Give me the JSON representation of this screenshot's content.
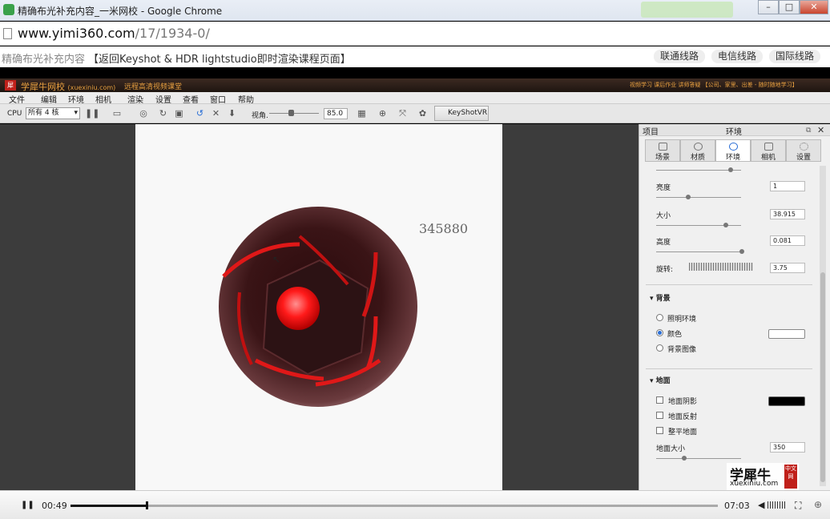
{
  "browser": {
    "window_title": "精确布光补充内容_一米网校 - Google Chrome",
    "url_host": "www.yimi360.com",
    "url_path": "/17/1934-0/"
  },
  "page": {
    "course_title": "精确布光补充内容",
    "back_link": "【返回Keyshot & HDR lightstudio即时渲染课程页面】",
    "routes": [
      "联通线路",
      "电信线路",
      "国际线路"
    ]
  },
  "keyshot": {
    "brand": "学犀牛网校",
    "brand_domain": "(xuexiniu.com)",
    "slogan": "远程高清视频课堂",
    "header_right": "视频学习  课后作业  讲师答疑  【公司、家里、出差 - 随时随地学习】",
    "menu": [
      "文件",
      "编辑",
      "环境",
      "相机",
      "渲染",
      "设置",
      "查看",
      "窗口",
      "帮助"
    ],
    "toolbar": {
      "cpu_label": "CPU",
      "cpu_value": "所有 4 核",
      "fov_label": "视角.",
      "fov_value": "85.0",
      "vr_button": "KeyShotVR"
    },
    "viewport_watermark": "345880"
  },
  "panel": {
    "project_label": "项目",
    "title": "环境",
    "tabs": [
      {
        "label": "场景",
        "icon": "scene-icon"
      },
      {
        "label": "材质",
        "icon": "material-icon"
      },
      {
        "label": "环境",
        "icon": "environment-icon"
      },
      {
        "label": "相机",
        "icon": "camera-icon"
      },
      {
        "label": "设置",
        "icon": "settings-icon"
      }
    ],
    "active_tab": 2,
    "fields": {
      "brightness_label": "亮度",
      "brightness_value": "1",
      "size_label": "大小",
      "size_value": "38.915",
      "height_label": "高度",
      "height_value": "0.081",
      "rotation_label": "旋转:",
      "rotation_value": "3.75"
    },
    "background": {
      "title": "背景",
      "options": [
        "照明环境",
        "颜色",
        "背景图像"
      ],
      "selected": 1,
      "color": "#ffffff"
    },
    "ground": {
      "title": "地面",
      "options": [
        "地面阴影",
        "地面反射",
        "整平地面"
      ],
      "shadow_color": "#000000",
      "size_label": "地面大小",
      "size_value": "350"
    }
  },
  "logo": {
    "name": "学犀牛",
    "domain": "xuexiniu.com",
    "tag": "中文网"
  },
  "player": {
    "current_time": "00:49",
    "total_time": "07:03",
    "progress": 0.116
  },
  "colors": {
    "accent_red": "#e01818",
    "keyshot_header": "#2e201a"
  }
}
